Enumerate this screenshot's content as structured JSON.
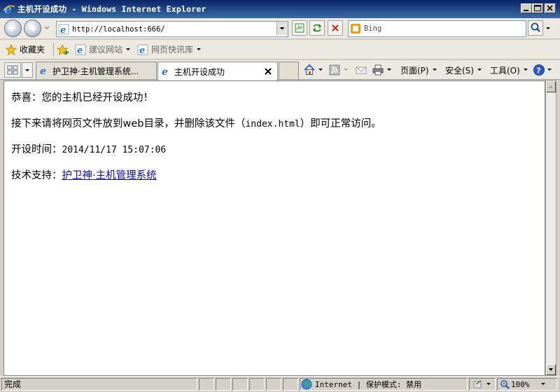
{
  "window": {
    "title": "主机开设成功 - Windows Internet Explorer",
    "minimize_icon": "minimize-icon",
    "maximize_icon": "maximize-icon",
    "close_icon": "close-icon"
  },
  "address_bar": {
    "url": "http://localhost:666/",
    "search_value": "Bing",
    "search_placeholder": "Bing"
  },
  "favorites_bar": {
    "favorites_label": "收藏夹",
    "items": [
      {
        "label": "建议网站",
        "has_dropdown": true
      },
      {
        "label": "网页快讯库",
        "has_dropdown": true
      }
    ]
  },
  "tabs": [
    {
      "label": "护卫神·主机管理系统...",
      "active": false
    },
    {
      "label": "主机开设成功",
      "active": true
    }
  ],
  "command_bar": {
    "page": "页面(P)",
    "safety": "安全(S)",
    "tools": "工具(O)",
    "help_icon": "help-icon"
  },
  "content": {
    "line1": "恭喜：您的主机已经开设成功！",
    "line2_pre": "接下来请将网页文件放到web目录，并删除该文件（",
    "line2_file": "index.html",
    "line2_post": "）即可正常访问。",
    "line3_label": "开设时间：",
    "line3_value": "2014/11/17 15:07:06",
    "line4_label": "技术支持：",
    "line4_link": "护卫神·主机管理系统"
  },
  "status_bar": {
    "status": "完成",
    "zone": "Internet | 保护模式: 禁用",
    "zoom": "100%"
  },
  "colors": {
    "titlebar": "#0a246a",
    "link": "#0a0aa8",
    "chrome": "#ece9e0"
  }
}
